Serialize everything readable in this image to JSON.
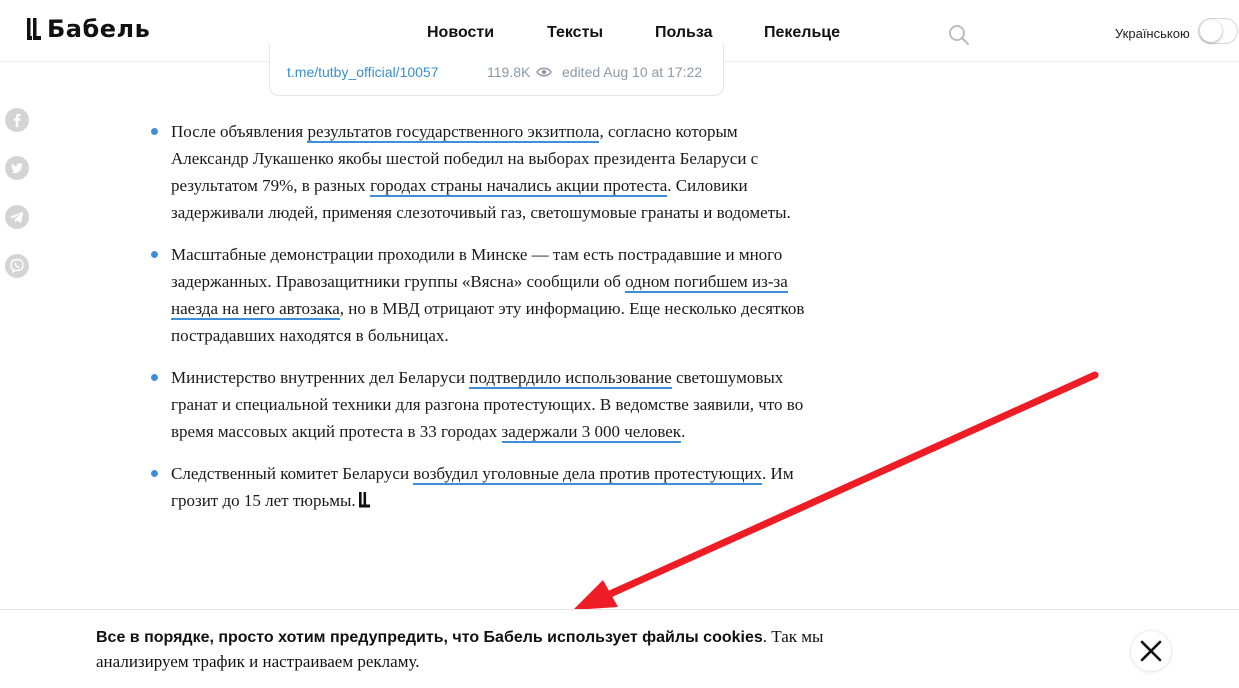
{
  "header": {
    "logo_text": "Бабель",
    "nav": [
      {
        "label": "Новости"
      },
      {
        "label": "Тексты"
      },
      {
        "label": "Польза"
      },
      {
        "label": "Пекельце"
      }
    ],
    "search_icon": "search-icon",
    "language_label": "Українською",
    "language_toggle_on": false
  },
  "telegram_embed": {
    "link": "t.me/tutby_official/10057",
    "views": "119.8K",
    "edited": "edited  Aug 10 at 17:22"
  },
  "share_icons": [
    "facebook-icon",
    "twitter-icon",
    "telegram-icon",
    "viber-icon"
  ],
  "article": {
    "items": [
      {
        "parts": [
          {
            "t": "После объявления "
          },
          {
            "t": "результатов государственного экзитпола",
            "link": true
          },
          {
            "t": ", согласно которым Александр Лукашенко якобы шестой победил на выборах президента Беларуси с результатом 79%, в разных "
          },
          {
            "t": "городах страны начались акции протеста",
            "link": true
          },
          {
            "t": ". Силовики задерживали людей, применяя слезоточивый газ, светошумовые гранаты и водометы."
          }
        ]
      },
      {
        "parts": [
          {
            "t": "Масштабные демонстрации проходили в Минске — там есть пострадавшие и много задержанных. Правозащитники группы «Вясна» сообщили об "
          },
          {
            "t": "одном погибшем из-за наезда на него автозака",
            "link": true
          },
          {
            "t": ", но в МВД отрицают эту информацию. Еще несколько десятков пострадавших находятся в больницах."
          }
        ]
      },
      {
        "parts": [
          {
            "t": "Министерство внутренних дел Беларуси "
          },
          {
            "t": "подтвердило использование",
            "link": true
          },
          {
            "t": " светошумовых гранат и специальной техники для разгона протестующих. В ведомстве заявили, что во время массовых акций протеста в 33 городах "
          },
          {
            "t": "задержали 3 000 человек",
            "link": true
          },
          {
            "t": "."
          }
        ]
      },
      {
        "parts": [
          {
            "t": "Следственный комитет Беларуси "
          },
          {
            "t": "возбудил уголовные дела против протестующих",
            "link": true
          },
          {
            "t": ". Им грозит до 15 лет тюрьмы."
          }
        ],
        "end_mark": true
      }
    ]
  },
  "cookie_banner": {
    "bold_text": "Все в порядке, просто хотим предупредить, что Бабель использует файлы cookies",
    "rest_text": ". Так мы анализируем трафик и настраиваем рекламу.",
    "close_icon": "close-icon"
  },
  "colors": {
    "link_underline": "#3e8ed8",
    "bullet": "#3e8ed8",
    "telegram_link": "#3a8fd0",
    "annotation_arrow": "#ee1c24"
  }
}
